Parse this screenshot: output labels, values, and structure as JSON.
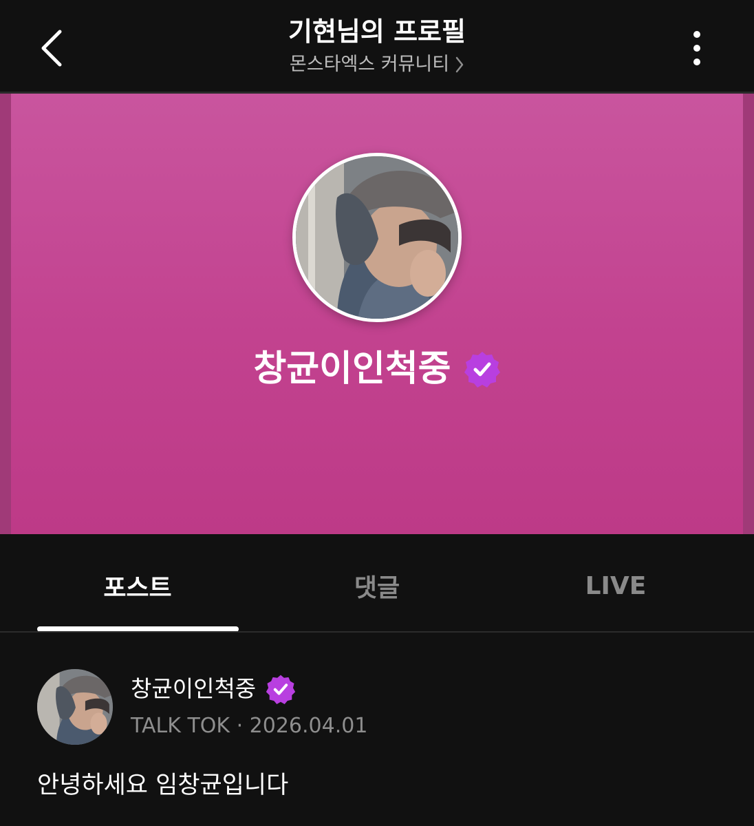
{
  "header": {
    "title": "기현님의 프로필",
    "subtitle": "몬스타엑스 커뮤니티",
    "back_icon": "chevron-left-icon",
    "subtitle_icon": "chevron-right-icon",
    "more_icon": "more-vertical-icon"
  },
  "profile": {
    "name": "창균이인척중",
    "verified": true,
    "verified_icon": "verified-badge-icon",
    "banner_color": "#c44a93",
    "badge_color": "#b83fe0"
  },
  "tabs": [
    {
      "label": "포스트",
      "active": true
    },
    {
      "label": "댓글",
      "active": false
    },
    {
      "label": "LIVE",
      "active": false
    }
  ],
  "post": {
    "author": "창균이인척중",
    "meta": "TALK TOK · 2026.04.01",
    "body": "안녕하세요 임창균입니다"
  }
}
